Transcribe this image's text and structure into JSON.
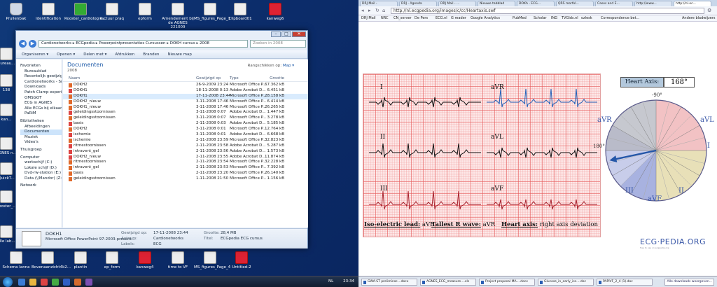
{
  "desktop": {
    "icons": [
      {
        "label": "Prullenbak",
        "style": "bin"
      },
      {
        "label": "Identification",
        "style": ""
      },
      {
        "label": "Rooster_cardiologie...",
        "style": "green"
      },
      {
        "label": "factuur praq",
        "style": ""
      },
      {
        "label": "epform",
        "style": ""
      },
      {
        "label": "Amendement bij de AGNES 221009",
        "style": ""
      },
      {
        "label": "MS_figures_Page_1",
        "style": ""
      },
      {
        "label": "Clipboard01",
        "style": ""
      },
      {
        "label": "kanweg6",
        "style": "red"
      },
      {
        "label": "Schema lanna",
        "style": ""
      },
      {
        "label": "Bovenaanzicht4k2...",
        "style": ""
      },
      {
        "label": "plantin",
        "style": ""
      },
      {
        "label": "ep_form",
        "style": ""
      },
      {
        "label": "kanweg4",
        "style": "red"
      },
      {
        "label": "time to VF",
        "style": ""
      },
      {
        "label": "MS_figures_Page_4",
        "style": ""
      },
      {
        "label": "Untitled-2",
        "style": "red"
      }
    ],
    "side_icons": [
      "Bureau...",
      "138",
      "kan...",
      "AGNES n...\ncoding...",
      "QuickT...",
      "Rooster_...",
      "alle lab...\nvergu..."
    ]
  },
  "explorer": {
    "address": "Cardionetworks ▸ ECGpedia ▸ Powerpointpresentaties Cursussen ▸ DOKH cursus ▸ 2008",
    "search_placeholder": "Zoeken in 2008",
    "toolbar": [
      "Organiseren ▾",
      "Openen ▾",
      "Delen met ▾",
      "Afdrukken",
      "Branden",
      "Nieuwe map"
    ],
    "nav": [
      {
        "label": "Favorieten",
        "head": true
      },
      {
        "label": "Bureaublad"
      },
      {
        "label": "Recentelijk gewijzigd"
      },
      {
        "label": "Cardionetworks - Sn"
      },
      {
        "label": "Downloads"
      },
      {
        "label": "Patch Clamp experi"
      },
      {
        "label": "OMSGOT"
      },
      {
        "label": "ECG in AGNES"
      },
      {
        "label": "Alle ECGs bij elkaar"
      },
      {
        "label": "PaRiM"
      },
      {
        "label": "Bibliotheken",
        "head": true
      },
      {
        "label": "Afbeeldingen"
      },
      {
        "label": "Documenten",
        "sel": true
      },
      {
        "label": "Muziek"
      },
      {
        "label": "Video's"
      },
      {
        "label": "Thuisgroep",
        "head": true
      },
      {
        "label": "Computer",
        "head": true
      },
      {
        "label": "werkschijf (C:)"
      },
      {
        "label": "Lokale schijf (D:)"
      },
      {
        "label": "Dvd-rw-station (E:)"
      },
      {
        "label": "Data (\\\\Mandor) (Z:)"
      },
      {
        "label": "Netwerk",
        "head": true
      }
    ],
    "library_title": "Documenten",
    "library_sub": "2008",
    "arrange_label": "Rangschikken op:",
    "arrange_value": "Map ▾",
    "columns": [
      "Naam",
      "Gewijzigd op",
      "Type",
      "Grootte"
    ],
    "files": [
      [
        "DOKH2",
        "26-9-2009 23:24",
        "Microsoft Office P...",
        "67.362 kB",
        "ppt"
      ],
      [
        "DOKH1",
        "18-11-2008 0:13",
        "Adobe Acrobat D...",
        "6.451 kB",
        "pdf"
      ],
      [
        "DOKH1",
        "17-11-2008 23:44",
        "Microsoft Office P...",
        "28.158 kB",
        "ppt",
        "sel"
      ],
      [
        "DOKH2_nieuw",
        "3-11-2008 17:46",
        "Microsoft Office P...",
        "6.414 kB",
        "ppt"
      ],
      [
        "DOKH1_nieuw",
        "3-11-2008 17:46",
        "Microsoft Office P...",
        "26.265 kB",
        "ppt"
      ],
      [
        "geleidingsstoornissen",
        "3-11-2008 0:07",
        "Adobe Acrobat D...",
        "1.447 kB",
        "pdf"
      ],
      [
        "geleidingsstoornissen",
        "3-11-2008 0:07",
        "Microsoft Office P...",
        "3.278 kB",
        "ppt"
      ],
      [
        "basis",
        "2-11-2008 0:03",
        "Adobe Acrobat D...",
        "5.185 kB",
        "pdf"
      ],
      [
        "DOKH2",
        "3-11-2008 0:01",
        "Microsoft Office P...",
        "12.764 kB",
        "ppt"
      ],
      [
        "ischemie",
        "3-11-2008 0:01",
        "Adobe Acrobat D...",
        "6.668 kB",
        "pdf"
      ],
      [
        "ischemie",
        "2-11-2008 23:59",
        "Microsoft Office P...",
        "32.823 kB",
        "ppt"
      ],
      [
        "ritmestoornissen",
        "2-11-2008 23:58",
        "Adobe Acrobat D...",
        "5.287 kB",
        "pdf"
      ],
      [
        "intravent_gel",
        "2-11-2008 23:56",
        "Adobe Acrobat D...",
        "1.573 kB",
        "pdf"
      ],
      [
        "DOKH2_nieuw",
        "2-11-2008 23:55",
        "Adobe Acrobat D...",
        "11.874 kB",
        "pdf"
      ],
      [
        "ritmestoornissen",
        "2-11-2008 23:54",
        "Microsoft Office P...",
        "32.228 kB",
        "ppt"
      ],
      [
        "intravent_gel",
        "2-11-2008 23:53",
        "Microsoft Office P...",
        "7.392 kB",
        "ppt"
      ],
      [
        "basis",
        "2-11-2008 23:20",
        "Microsoft Office P...",
        "26.140 kB",
        "ppt"
      ],
      [
        "geleidingsstoornissen",
        "1-11-2008 21:50",
        "Microsoft Office P...",
        "1.156 kB",
        "ppt"
      ]
    ],
    "details": {
      "name": "DOKH1",
      "type": "Microsoft Office PowerPoint 97-2003-present...",
      "modified_label": "Gewijzigd op:",
      "modified": "17-11-2008 23:44",
      "authors_label": "Auteurs:",
      "authors": "Cardionetworks",
      "labels_label": "Labels:",
      "labels": "ECG",
      "size_label": "Grootte:",
      "size": "28,4 MB",
      "title_label": "Titel:",
      "title": "ECGpedia ECG cursus"
    }
  },
  "left_taskbar": {
    "tray": "NL",
    "clock": "23:34"
  },
  "browser": {
    "tabs": [
      {
        "label": "DRJ Mail -",
        "active": false
      },
      {
        "label": "DRJ - Agenda",
        "active": false
      },
      {
        "label": "DRJ Mail - ...",
        "active": false
      },
      {
        "label": "Nieuwe tabblad",
        "active": false
      },
      {
        "label": "DOKh - ECG...",
        "active": false
      },
      {
        "label": "QRS morfol...",
        "active": false
      },
      {
        "label": "Cases and E...",
        "active": false
      },
      {
        "label": "http://www...",
        "active": false
      },
      {
        "label": "http://nl.ec...",
        "active": true
      }
    ],
    "url": "http://nl.ecgpedia.org/images/c/cc/Heartaxis.swf",
    "bookmarks": [
      "DRJ Mail",
      "NRC",
      "CN_server",
      "De Pers",
      "ECG.nl",
      "G reader",
      "Google Analytics",
      "PubMed",
      "Scholar",
      "ING",
      "TVGids.nl",
      "ozlesk",
      "Correspondence bet...",
      "Andere bladwijzers"
    ]
  },
  "ecg": {
    "leads": [
      "I",
      "aVR",
      "II",
      "aVL",
      "III",
      "aVF"
    ],
    "caption": {
      "iso_label": "Iso-electric lead:",
      "iso_value": "aVF",
      "tallest_label": "Tallest R wave:",
      "tallest_value": "aVR",
      "axis_label": "Heart axis:",
      "axis_value": "right axis deviation"
    },
    "heart_axis_label": "Heart Axis:",
    "heart_axis_value": "168°",
    "circle_labels": {
      "top": "-90°",
      "left": "180°",
      "avr": "aVR",
      "avl": "aVL",
      "i": "I",
      "iii": "III",
      "ii": "II",
      "avf": "aVF"
    },
    "logo": "ECG·PEDIA.ORG",
    "logo_sub": "free to use on ecgpedia.org",
    "axis_degrees": 168
  },
  "downloads": {
    "items": [
      "GWA-ST preliminar....docx",
      "AGNES_ECG_measure....xls",
      "Project proposal MA....docx",
      "Glucose_in_early_isc....doc",
      "PAPIVF_2_4 (1).doc"
    ],
    "show_all": "Alle downloads weergeven..."
  }
}
